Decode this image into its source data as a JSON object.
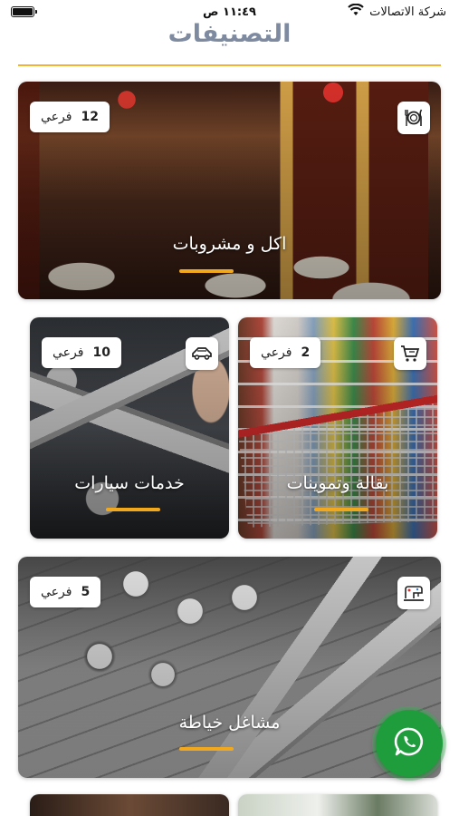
{
  "status_bar": {
    "carrier": "شركة الاتصالات",
    "time": "١١:٤٩ ص"
  },
  "header": {
    "title": "التصنيفات"
  },
  "colors": {
    "accent": "#f2a81d",
    "title": "#7e8aa0",
    "whatsapp": "#1f9d3c"
  },
  "categories": [
    {
      "label": "اكل و مشروبات",
      "count": "12",
      "count_unit": "فرعي",
      "icon": "restaurant-icon"
    },
    {
      "label": "بقالة وتموينات",
      "count": "2",
      "count_unit": "فرعي",
      "icon": "shopping-cart-icon"
    },
    {
      "label": "خدمات سيارات",
      "count": "10",
      "count_unit": "فرعي",
      "icon": "car-icon"
    },
    {
      "label": "مشاغل خياطة",
      "count": "5",
      "count_unit": "فرعي",
      "icon": "sewing-machine-icon"
    }
  ],
  "fab": {
    "icon": "whatsapp-icon"
  }
}
